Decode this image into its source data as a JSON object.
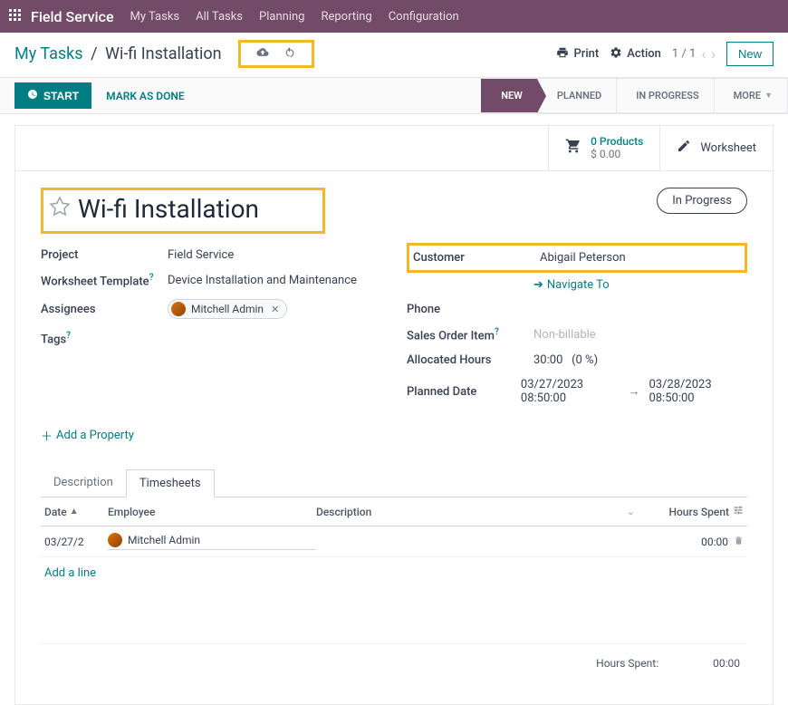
{
  "navbar": {
    "brand": "Field Service",
    "menu": [
      "My Tasks",
      "All Tasks",
      "Planning",
      "Reporting",
      "Configuration"
    ]
  },
  "breadcrumb": {
    "parent": "My Tasks",
    "current": "Wi-fi Installation"
  },
  "topActions": {
    "print": "Print",
    "action": "Action",
    "pager": "1 / 1",
    "newBtn": "New"
  },
  "statusBar": {
    "start": "START",
    "markDone": "MARK AS DONE",
    "stages": [
      "NEW",
      "PLANNED",
      "IN PROGRESS",
      "MORE"
    ],
    "activeStage": "NEW"
  },
  "sheetTop": {
    "productsLine": "0 Products",
    "productsAmt": "$ 0.00",
    "worksheet": "Worksheet"
  },
  "task": {
    "title": "Wi-fi Installation",
    "stagePill": "In Progress",
    "project": {
      "label": "Project",
      "value": "Field Service"
    },
    "worksheetTemplate": {
      "label": "Worksheet Template",
      "value": "Device Installation and Maintenance"
    },
    "assignees": {
      "label": "Assignees",
      "value": "Mitchell Admin"
    },
    "tags": {
      "label": "Tags",
      "value": ""
    },
    "customer": {
      "label": "Customer",
      "value": "Abigail Peterson"
    },
    "navigateTo": "Navigate To",
    "phone": {
      "label": "Phone",
      "value": ""
    },
    "salesOrderItem": {
      "label": "Sales Order Item",
      "placeholder": "Non-billable"
    },
    "allocatedHours": {
      "label": "Allocated Hours",
      "value": "30:00",
      "pct": "(0 %)"
    },
    "plannedDate": {
      "label": "Planned Date",
      "start": "03/27/2023 08:50:00",
      "end": "03/28/2023 08:50:00"
    }
  },
  "addProperty": "Add a Property",
  "tabs": {
    "description": "Description",
    "timesheets": "Timesheets"
  },
  "tsHead": {
    "date": "Date",
    "employee": "Employee",
    "description": "Description",
    "hours": "Hours Spent"
  },
  "tsRows": [
    {
      "date": "03/27/2",
      "employee": "Mitchell Admin",
      "description": "",
      "hours": "00:00"
    }
  ],
  "addLine": "Add a line",
  "tsFoot": {
    "label": "Hours Spent:",
    "value": "00:00"
  }
}
